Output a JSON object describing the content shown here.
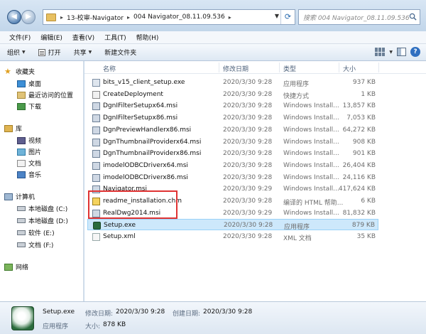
{
  "address": {
    "crumbs": [
      "13-校审-Navigator",
      "004 Navigator_08.11.09.536"
    ],
    "search_placeholder": "搜索 004 Navigator_08.11.09.536"
  },
  "menu": [
    "文件(F)",
    "编辑(E)",
    "查看(V)",
    "工具(T)",
    "帮助(H)"
  ],
  "toolbar": {
    "organize": "组织",
    "open": "打开",
    "share": "共享",
    "new_folder": "新建文件夹"
  },
  "nav": {
    "favorites": "收藏夹",
    "desktop": "桌面",
    "recent": "最近访问的位置",
    "downloads": "下载",
    "libraries": "库",
    "videos": "视频",
    "pictures": "图片",
    "documents": "文档",
    "music": "音乐",
    "computer": "计算机",
    "disk_c": "本地磁盘 (C:)",
    "disk_d": "本地磁盘 (D:)",
    "disk_e": "软件 (E:)",
    "disk_f": "文档 (F:)",
    "network": "网络"
  },
  "columns": {
    "name": "名称",
    "date": "修改日期",
    "type": "类型",
    "size": "大小"
  },
  "files": [
    {
      "name": "bits_v15_client_setup.exe",
      "date": "2020/3/30 9:28",
      "type": "应用程序",
      "size": "937 KB",
      "icon": "exe"
    },
    {
      "name": "CreateDeployment",
      "date": "2020/3/30 9:28",
      "type": "快捷方式",
      "size": "1 KB",
      "icon": "lnk"
    },
    {
      "name": "DgnIFilterSetupx64.msi",
      "date": "2020/3/30 9:28",
      "type": "Windows Install...",
      "size": "13,857 KB",
      "icon": "msi"
    },
    {
      "name": "DgnIFilterSetupx86.msi",
      "date": "2020/3/30 9:28",
      "type": "Windows Install...",
      "size": "7,053 KB",
      "icon": "msi"
    },
    {
      "name": "DgnPreviewHandlerx86.msi",
      "date": "2020/3/30 9:28",
      "type": "Windows Install...",
      "size": "64,272 KB",
      "icon": "msi"
    },
    {
      "name": "DgnThumbnailProviderx64.msi",
      "date": "2020/3/30 9:28",
      "type": "Windows Install...",
      "size": "908 KB",
      "icon": "msi"
    },
    {
      "name": "DgnThumbnailProviderx86.msi",
      "date": "2020/3/30 9:28",
      "type": "Windows Install...",
      "size": "901 KB",
      "icon": "msi"
    },
    {
      "name": "imodelODBCDriverx64.msi",
      "date": "2020/3/30 9:28",
      "type": "Windows Install...",
      "size": "26,404 KB",
      "icon": "msi"
    },
    {
      "name": "imodelODBCDriverx86.msi",
      "date": "2020/3/30 9:28",
      "type": "Windows Install...",
      "size": "24,116 KB",
      "icon": "msi"
    },
    {
      "name": "Navigator.msi",
      "date": "2020/3/30 9:29",
      "type": "Windows Install...",
      "size": "417,624 KB",
      "icon": "msi"
    },
    {
      "name": "readme_installation.chm",
      "date": "2020/3/30 9:28",
      "type": "编译的 HTML 帮助...",
      "size": "6 KB",
      "icon": "chm"
    },
    {
      "name": "RealDwg2014.msi",
      "date": "2020/3/30 9:29",
      "type": "Windows Install...",
      "size": "81,832 KB",
      "icon": "msi"
    },
    {
      "name": "Setup.exe",
      "date": "2020/3/30 9:28",
      "type": "应用程序",
      "size": "879 KB",
      "icon": "setup",
      "selected": true
    },
    {
      "name": "Setup.xml",
      "date": "2020/3/30 9:28",
      "type": "XML 文档",
      "size": "35 KB",
      "icon": "xml"
    }
  ],
  "details": {
    "name": "Setup.exe",
    "modified_label": "修改日期:",
    "modified": "2020/3/30 9:28",
    "created_label": "创建日期:",
    "created": "2020/3/30 9:28",
    "type": "应用程序",
    "size_label": "大小:",
    "size": "878 KB"
  },
  "colors": {
    "highlight": "#e03333",
    "selection": "#cde8fb"
  }
}
